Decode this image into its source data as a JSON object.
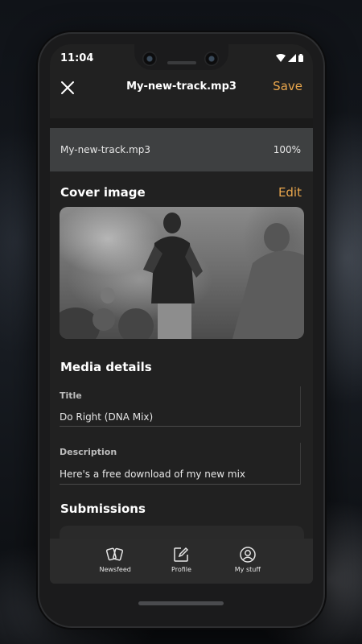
{
  "status_bar": {
    "time": "11:04"
  },
  "header": {
    "title": "My-new-track.mp3",
    "save_label": "Save"
  },
  "upload": {
    "file_name": "My-new-track.mp3",
    "progress": "100%"
  },
  "cover_section": {
    "title": "Cover image",
    "edit_label": "Edit"
  },
  "media_details": {
    "title": "Media details",
    "fields": [
      {
        "label": "Title",
        "value": "Do Right (DNA Mix)"
      },
      {
        "label": "Description",
        "value": "Here's a free download of my new mix"
      }
    ]
  },
  "submissions": {
    "title": "Submissions"
  },
  "tabs": [
    {
      "label": "Newsfeed",
      "icon": "cards-icon"
    },
    {
      "label": "Profile",
      "icon": "edit-square-icon"
    },
    {
      "label": "My stuff",
      "icon": "person-circle-icon"
    }
  ],
  "colors": {
    "accent": "#e9a64c",
    "screen_bg": "#212121",
    "upload_bar": "#3e4041",
    "tab_bar": "#2b2b2b"
  }
}
